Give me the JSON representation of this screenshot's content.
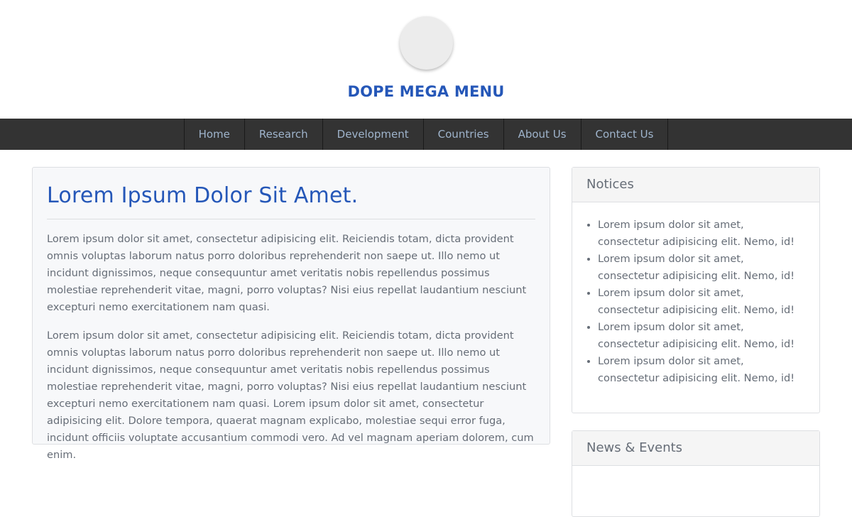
{
  "header": {
    "title": "DOPE MEGA MENU",
    "logo_icon": "circle-logo-icon"
  },
  "nav": {
    "items": [
      {
        "label": "Home"
      },
      {
        "label": "Research"
      },
      {
        "label": "Development"
      },
      {
        "label": "Countries"
      },
      {
        "label": "About Us"
      },
      {
        "label": "Contact Us"
      }
    ]
  },
  "article": {
    "title": "Lorem Ipsum Dolor Sit Amet.",
    "paragraphs": [
      "Lorem ipsum dolor sit amet, consectetur adipisicing elit. Reiciendis totam, dicta provident omnis voluptas laborum natus porro doloribus reprehenderit non saepe ut. Illo nemo ut incidunt dignissimos, neque consequuntur amet veritatis nobis repellendus possimus molestiae reprehenderit vitae, magni, porro voluptas? Nisi eius repellat laudantium nesciunt excepturi nemo exercitationem nam quasi.",
      "Lorem ipsum dolor sit amet, consectetur adipisicing elit. Reiciendis totam, dicta provident omnis voluptas laborum natus porro doloribus reprehenderit non saepe ut. Illo nemo ut incidunt dignissimos, neque consequuntur amet veritatis nobis repellendus possimus molestiae reprehenderit vitae, magni, porro voluptas? Nisi eius repellat laudantium nesciunt excepturi nemo exercitationem nam quasi. Lorem ipsum dolor sit amet, consectetur adipisicing elit. Dolore tempora, quaerat magnam explicabo, molestiae sequi error fuga, incidunt officiis voluptate accusantium commodi vero. Ad vel magnam aperiam dolorem, cum enim."
    ]
  },
  "notices": {
    "heading": "Notices",
    "items": [
      "Lorem ipsum dolor sit amet, consectetur adipisicing elit. Nemo, id!",
      "Lorem ipsum dolor sit amet, consectetur adipisicing elit. Nemo, id!",
      "Lorem ipsum dolor sit amet, consectetur adipisicing elit. Nemo, id!",
      "Lorem ipsum dolor sit amet, consectetur adipisicing elit. Nemo, id!",
      "Lorem ipsum dolor sit amet, consectetur adipisicing elit. Nemo, id!"
    ]
  },
  "news": {
    "heading": "News & Events"
  },
  "colors": {
    "brand": "#2557b8",
    "nav_bg": "#333333",
    "nav_text": "#9fb4cc",
    "body_text": "#666d77"
  }
}
